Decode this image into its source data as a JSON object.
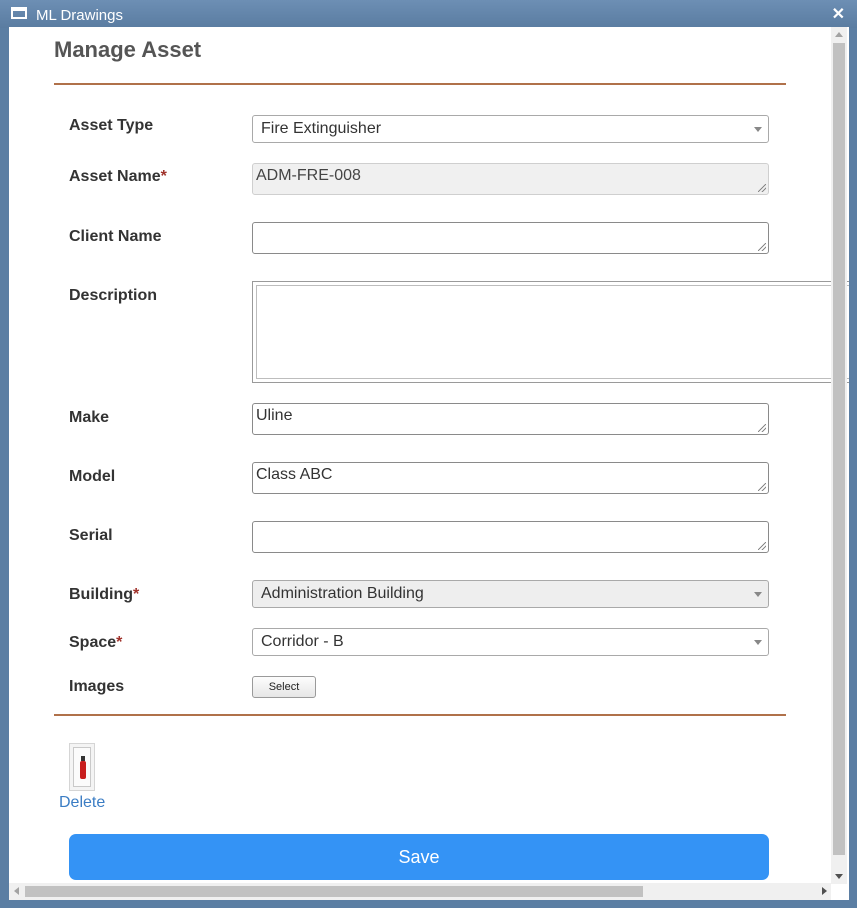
{
  "window": {
    "title": "ML Drawings",
    "close_glyph": "✕"
  },
  "form": {
    "heading": "Manage Asset",
    "asset_type": {
      "label": "Asset Type",
      "value": "Fire Extinguisher"
    },
    "asset_name": {
      "label": "Asset Name",
      "required_mark": "*",
      "value": "ADM-FRE-008"
    },
    "client_name": {
      "label": "Client Name",
      "value": ""
    },
    "description": {
      "label": "Description",
      "value": ""
    },
    "make": {
      "label": "Make",
      "value": "Uline"
    },
    "model": {
      "label": "Model",
      "value": "Class ABC"
    },
    "serial": {
      "label": "Serial",
      "value": ""
    },
    "building": {
      "label": "Building",
      "required_mark": "*",
      "value": "Administration Building"
    },
    "space": {
      "label": "Space",
      "required_mark": "*",
      "value": "Corridor - B"
    },
    "images": {
      "label": "Images",
      "select_button": "Select"
    }
  },
  "image_item": {
    "icon": "fire-extinguisher-thumbnail",
    "delete_label": "Delete"
  },
  "actions": {
    "save_label": "Save"
  },
  "colors": {
    "titlebar": "#5b7ea3",
    "accent_rule": "#b0714a",
    "save_button": "#3493f5",
    "link": "#3b7dc4",
    "required": "#a0322b"
  }
}
